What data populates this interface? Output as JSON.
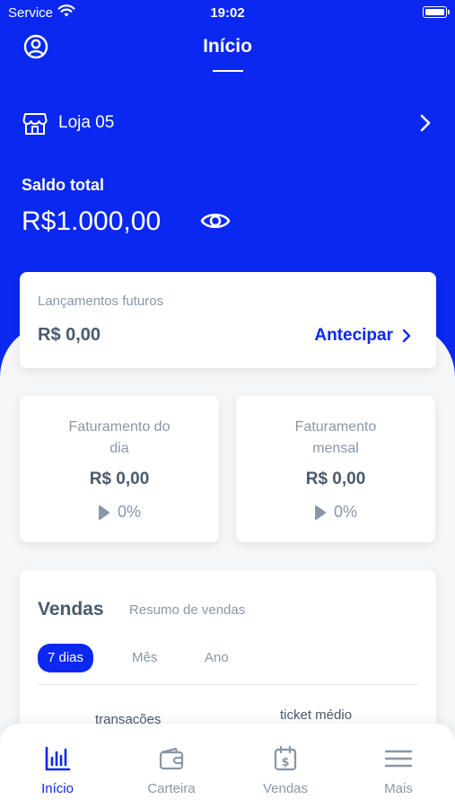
{
  "status_bar": {
    "carrier": "Service",
    "time": "19:02"
  },
  "header": {
    "title": "Início"
  },
  "store": {
    "name": "Loja 05"
  },
  "balance": {
    "label": "Saldo total",
    "value": "R$1.000,00"
  },
  "future": {
    "label": "Lançamentos futuros",
    "value": "R$ 0,00",
    "action": "Antecipar"
  },
  "revenue_day": {
    "label": "Faturamento do dia",
    "value": "R$ 0,00",
    "change": "0%"
  },
  "revenue_month": {
    "label": "Faturamento mensal",
    "value": "R$ 0,00",
    "change": "0%"
  },
  "sales": {
    "title": "Vendas",
    "subtitle": "Resumo de vendas",
    "periods": [
      "7 dias",
      "Mês",
      "Ano"
    ],
    "selected_period": "7 dias",
    "metrics": [
      "transações",
      "ticket médio"
    ]
  },
  "tabbar": {
    "items": [
      {
        "label": "Início",
        "icon": "bar-chart-icon",
        "active": true
      },
      {
        "label": "Carteira",
        "icon": "wallet-icon",
        "active": false
      },
      {
        "label": "Vendas",
        "icon": "calendar-dollar-icon",
        "active": false
      },
      {
        "label": "Mais",
        "icon": "menu-icon",
        "active": false
      }
    ]
  },
  "colors": {
    "primary": "#0a28f0",
    "background": "#f5f6f8",
    "text_dark": "#4a5a6c",
    "text_muted": "#8a96a6"
  }
}
